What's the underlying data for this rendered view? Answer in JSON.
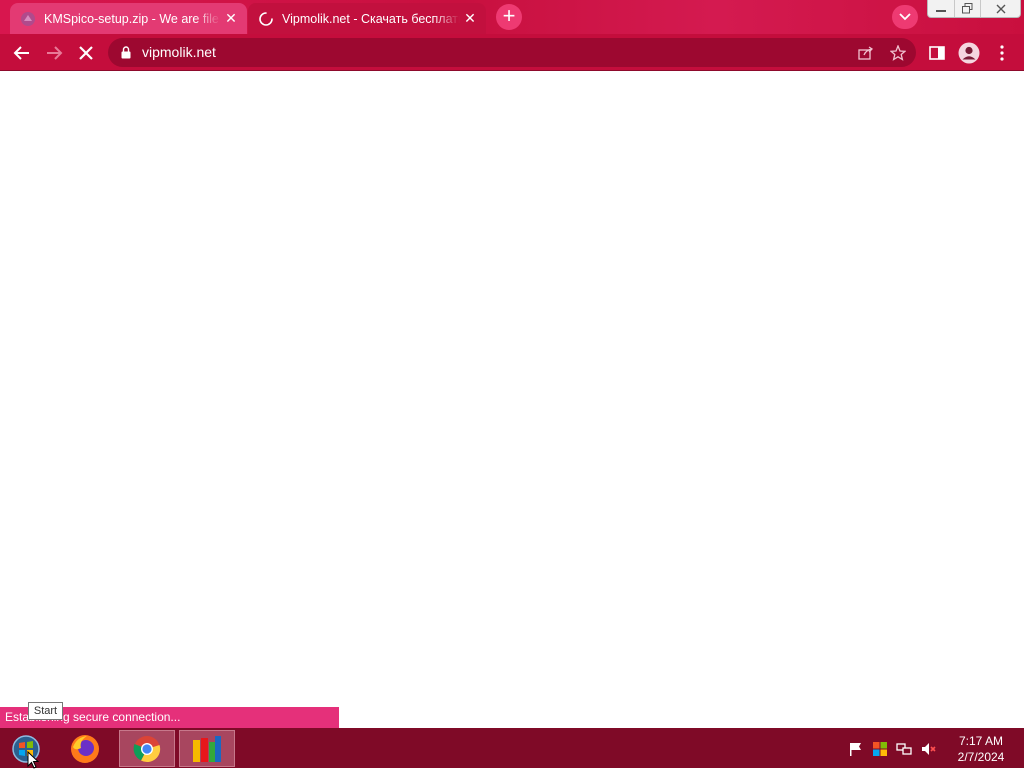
{
  "browser": {
    "tabs": [
      {
        "title": "KMSpico-setup.zip - We are file f",
        "icon": "page-favicon-icon",
        "state": "inactive"
      },
      {
        "title": "Vipmolik.net - Скачать бесплатн",
        "icon": "loading-spinner-icon",
        "state": "active-loading"
      }
    ],
    "new_tab_label": "+",
    "url": "vipmolik.net",
    "status_text": "Establishing secure connection...",
    "colors": {
      "theme": "#c40d3c",
      "active_tab": "#e33a73",
      "omnibox": "#9d0830"
    }
  },
  "tooltip": {
    "text": "Start"
  },
  "taskbar": {
    "apps": [
      "start-orb-icon",
      "firefox-icon",
      "chrome-icon",
      "avg-icon"
    ],
    "clock_time": "7:17 AM",
    "clock_date": "2/7/2024"
  }
}
